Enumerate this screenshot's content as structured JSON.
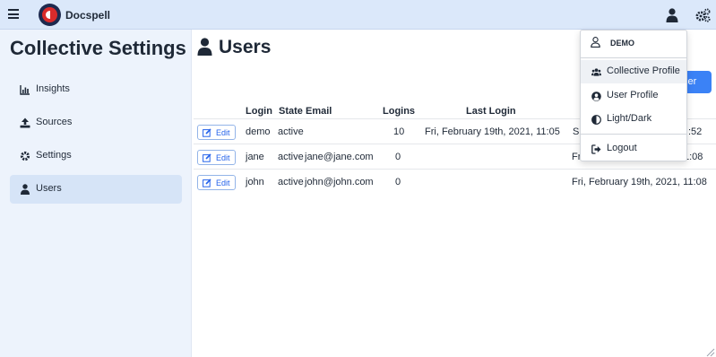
{
  "app": {
    "name": "Docspell"
  },
  "sidebar": {
    "title": "Collective Settings",
    "items": [
      {
        "label": "Insights",
        "icon": "chart-bar-icon",
        "active": false
      },
      {
        "label": "Sources",
        "icon": "upload-icon",
        "active": false
      },
      {
        "label": "Settings",
        "icon": "gear-icon",
        "active": false
      },
      {
        "label": "Users",
        "icon": "user-icon",
        "active": true
      }
    ]
  },
  "main": {
    "title": "Users",
    "add_button_label": "ser",
    "table": {
      "columns": [
        "Login",
        "State",
        "Email",
        "Logins",
        "Last Login"
      ],
      "edit_label": "Edit",
      "rows": [
        {
          "login": "demo",
          "state": "active",
          "email": "",
          "logins": "10",
          "last_login": "Fri, February 19th, 2021, 11:05",
          "extra": "S",
          "extra2": ":52"
        },
        {
          "login": "jane",
          "state": "active",
          "email": "jane@jane.com",
          "logins": "0",
          "last_login": "",
          "extra": "Fri",
          "extra2": "1:08"
        },
        {
          "login": "john",
          "state": "active",
          "email": "john@john.com",
          "logins": "0",
          "last_login": "",
          "extra": "Fri, February 19th, 2021, 11:08",
          "extra2": ""
        }
      ]
    }
  },
  "user_menu": {
    "username": "DEMO",
    "items": [
      {
        "label": "Collective Profile",
        "icon": "users-icon"
      },
      {
        "label": "User Profile",
        "icon": "user-circle-icon"
      },
      {
        "label": "Light/Dark",
        "icon": "adjust-icon"
      },
      {
        "label": "Logout",
        "icon": "sign-out-icon"
      }
    ]
  },
  "colors": {
    "accent": "#3b82f6",
    "topbar": "#dbe8fa",
    "sidebar": "#edf3fc"
  }
}
